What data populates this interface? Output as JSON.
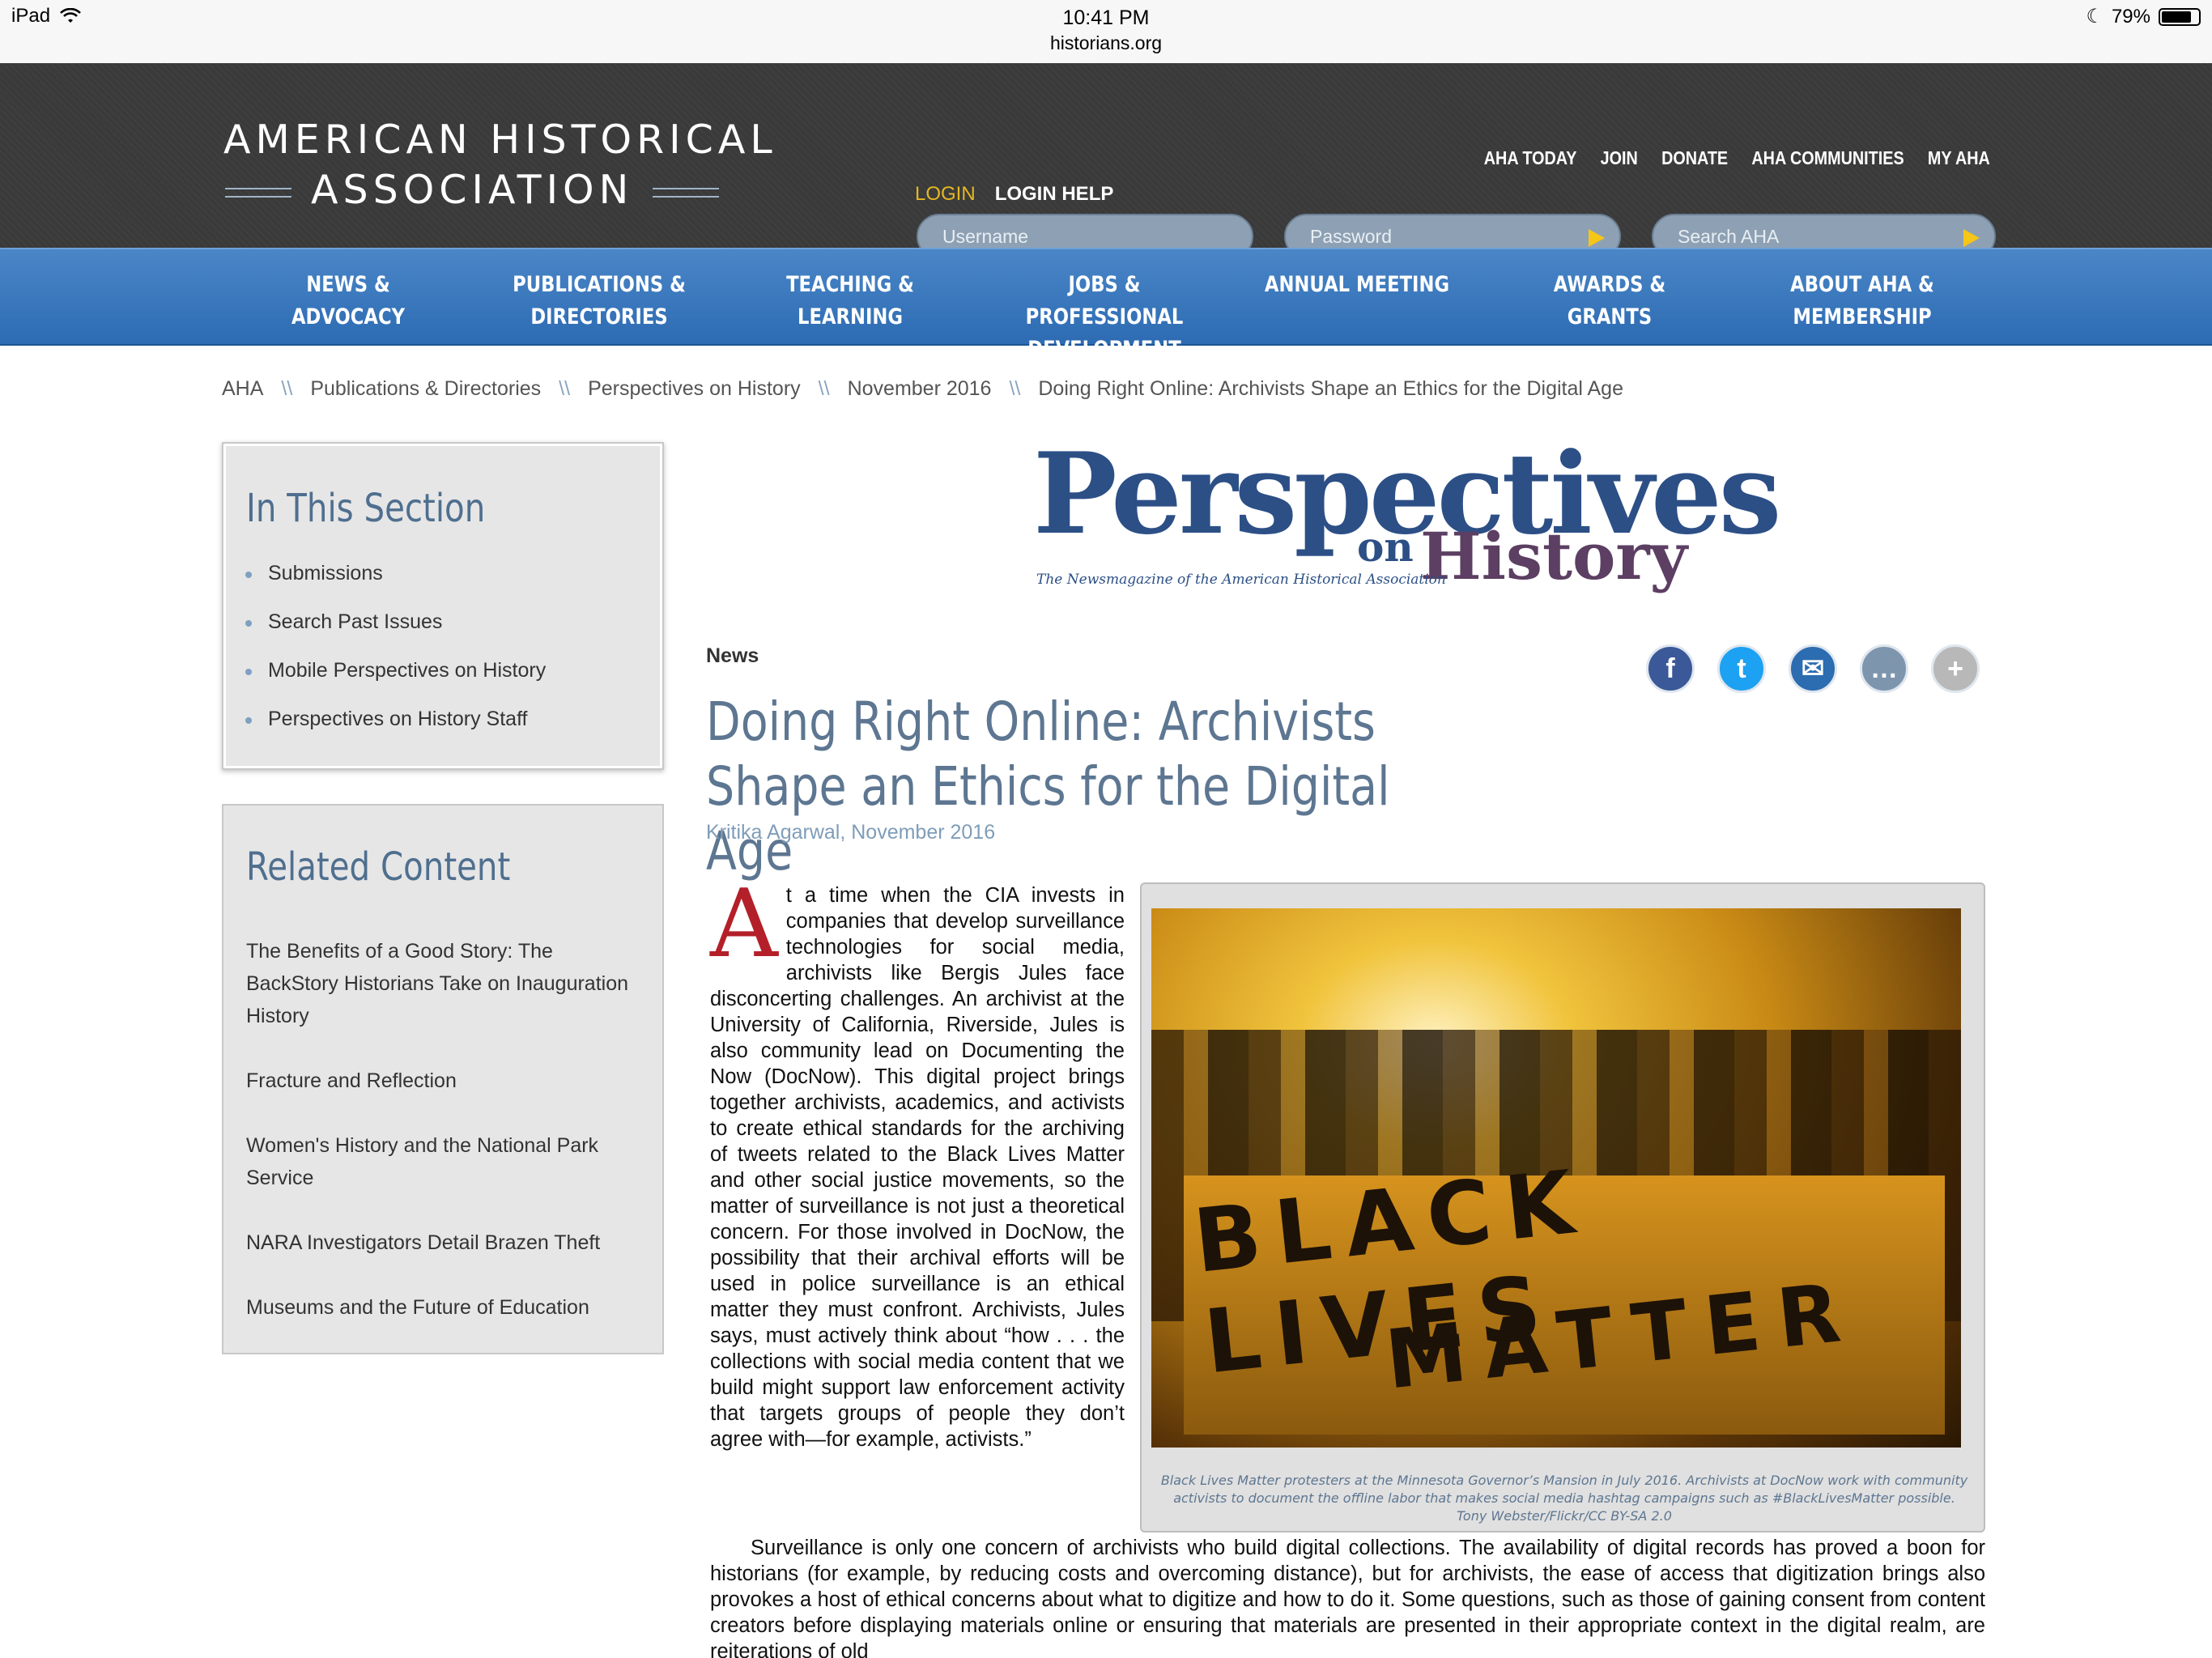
{
  "status": {
    "device": "iPad",
    "time": "10:41 PM",
    "url": "historians.org",
    "battery": "79%"
  },
  "logo": {
    "line1": "AMERICAN HISTORICAL",
    "line2": "ASSOCIATION"
  },
  "topnav": [
    "AHA TODAY",
    "JOIN",
    "DONATE",
    "AHA COMMUNITIES",
    "MY AHA"
  ],
  "login": {
    "login_label": "LOGIN",
    "help_label": "LOGIN HELP",
    "username_placeholder": "Username",
    "password_placeholder": "Password",
    "search_placeholder": "Search AHA"
  },
  "mainnav": [
    {
      "line1": "NEWS & ADVOCACY",
      "line2": ""
    },
    {
      "line1": "PUBLICATIONS &",
      "line2": "DIRECTORIES"
    },
    {
      "line1": "TEACHING & LEARNING",
      "line2": ""
    },
    {
      "line1": "JOBS & PROFESSIONAL",
      "line2": "DEVELOPMENT"
    },
    {
      "line1": "ANNUAL MEETING",
      "line2": ""
    },
    {
      "line1": "AWARDS & GRANTS",
      "line2": ""
    },
    {
      "line1": "ABOUT AHA &",
      "line2": "MEMBERSHIP"
    }
  ],
  "breadcrumb": {
    "sep": "\\\\",
    "items": [
      "AHA",
      "Publications & Directories",
      "Perspectives on History",
      "November 2016",
      "Doing Right Online: Archivists Shape an Ethics for the Digital Age"
    ]
  },
  "section": {
    "title": "In This Section",
    "items": [
      "Submissions",
      "Search Past Issues",
      "Mobile Perspectives on History",
      "Perspectives on History Staff"
    ]
  },
  "related": {
    "title": "Related Content",
    "items": [
      "The Benefits of a Good Story: The BackStory Historians Take on Inauguration History",
      "Fracture and Reflection",
      "Women's History and the National Park Service",
      "NARA Investigators Detail Brazen Theft",
      "Museums and the Future of Education"
    ]
  },
  "masthead": {
    "main": "Perspectives",
    "on": "on",
    "history": "History",
    "tagline": "The Newsmagazine of the American Historical Association"
  },
  "article": {
    "kicker": "News",
    "title": "Doing Right Online: Archivists Shape an Ethics for the Digital Age",
    "byline": "Kritika Agarwal, November 2016",
    "dropcap": "A",
    "para1": "t a time when the CIA invests in companies that develop surveillance technologies for social media, archivists like Bergis Jules face disconcerting challenges. An archivist at the University of California, Riverside, Jules is also community lead on Documenting the Now (DocNow). This digital project brings together archivists, academics, and activists to create ethical standards for the archiving of tweets related to the Black Lives Matter and other social justice movements, so the matter of surveillance is not just a theoretical concern. For those involved in DocNow, the possibility that their archival efforts will be used in police surveillance is an ethical matter they must confront. Archivists, Jules says, must actively think about “how . . . the collections with social media content that we build might support law enforcement activity that targets groups of people they don’t agree with—for example, activists.”",
    "para2": "Surveillance is only one concern of archivists who build digital collections. The availability of digital records has proved a boon for historians (for example, by reducing costs and overcoming distance), but for archivists, the ease of access that digitization brings also provokes a host of ethical concerns about what to digitize and how to do it. Some questions, such as those of gaining consent from content creators before displaying materials online or ensuring that materials are presented in their appropriate context in the digital realm, are reiterations of old",
    "photo_text1": "BLACK LIVES",
    "photo_text2": "MATTER",
    "caption": "Black Lives Matter protesters at the Minnesota Governor’s Mansion in July 2016. Archivists at DocNow work with community activists to document the offline labor that makes social media hashtag campaigns such as #BlackLivesMatter possible. Tony Webster/Flickr/CC BY-SA 2.0"
  },
  "social": [
    {
      "icon": "facebook-icon",
      "glyph": "f",
      "color": "#3b5998"
    },
    {
      "icon": "twitter-icon",
      "glyph": "t",
      "color": "#1da1f2"
    },
    {
      "icon": "email-icon",
      "glyph": "✉",
      "color": "#2c6cb0"
    },
    {
      "icon": "comment-icon",
      "glyph": "…",
      "color": "#7d95ad"
    },
    {
      "icon": "plus-icon",
      "glyph": "+",
      "color": "#b8b8b8"
    }
  ]
}
